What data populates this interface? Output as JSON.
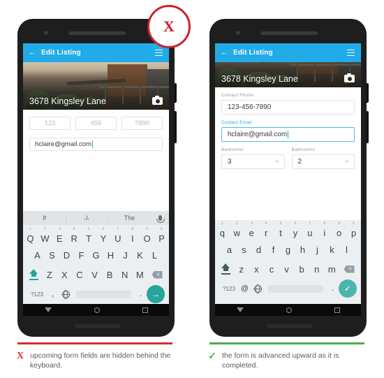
{
  "left": {
    "badge": {
      "glyph": "X",
      "name": "x-badge",
      "color": "#CE2029"
    },
    "appbar": {
      "back_icon": "back-arrow-icon",
      "title": "Edit Listing",
      "menu_icon": "hamburger-menu-icon"
    },
    "hero": {
      "caption": "3678 Kingsley Lane",
      "camera_icon": "camera-icon"
    },
    "form": {
      "phone_parts": [
        "123",
        "456",
        "7890"
      ],
      "email_value": "hclaire@gmail.com"
    },
    "keyboard": {
      "suggestions": [
        "If",
        "I",
        "The"
      ],
      "mic_icon": "microphone-icon",
      "row1": [
        "Q",
        "W",
        "E",
        "R",
        "T",
        "Y",
        "U",
        "I",
        "O",
        "P"
      ],
      "row1_nums": [
        "1",
        "2",
        "3",
        "4",
        "5",
        "6",
        "7",
        "8",
        "9",
        "0"
      ],
      "row2": [
        "A",
        "S",
        "D",
        "F",
        "G",
        "H",
        "J",
        "K",
        "L"
      ],
      "row3": [
        "Z",
        "X",
        "C",
        "V",
        "B",
        "N",
        "M"
      ],
      "shift_icon": "shift-key-icon",
      "backspace_icon": "backspace-key-icon",
      "symbols_key": "?123",
      "comma_key": ",",
      "globe_icon": "globe-language-icon",
      "period_key": ".",
      "enter_glyph": "→",
      "enter_icon": "enter-arrow-icon"
    },
    "navbar": {
      "back_icon": "nav-back-icon",
      "home_icon": "nav-home-icon",
      "recents_icon": "nav-recents-icon"
    },
    "caption": {
      "mark": "X",
      "text": "upcoming form fields are hidden behind the keyboard."
    },
    "rule_color": "#D32F2F"
  },
  "right": {
    "badge": {
      "glyph": "✓",
      "name": "check-badge",
      "color": "#2EA84F"
    },
    "appbar": {
      "back_icon": "back-arrow-icon",
      "title": "Edit Listing",
      "menu_icon": "hamburger-menu-icon"
    },
    "hero": {
      "caption": "3678 Kingsley Lane",
      "camera_icon": "camera-icon"
    },
    "form": {
      "phone_label": "Contact Phone",
      "phone_value": "123-456-7890",
      "email_label": "Contact Email",
      "email_value": "hclaire@gmail.com",
      "bedrooms_label": "Bedrooms",
      "bedrooms_value": "3",
      "bathrooms_label": "Bathrooms",
      "bathrooms_value": "2",
      "active_color": "#21ABE8"
    },
    "keyboard": {
      "row1": [
        "q",
        "w",
        "e",
        "r",
        "t",
        "y",
        "u",
        "i",
        "o",
        "p"
      ],
      "row1_nums": [
        "1",
        "2",
        "3",
        "4",
        "5",
        "6",
        "7",
        "8",
        "9",
        "0"
      ],
      "row2": [
        "a",
        "s",
        "d",
        "f",
        "g",
        "h",
        "j",
        "k",
        "l"
      ],
      "row3": [
        "z",
        "x",
        "c",
        "v",
        "b",
        "n",
        "m"
      ],
      "shift_icon": "shift-key-icon",
      "backspace_icon": "backspace-key-icon",
      "symbols_key": "?123",
      "at_key": "@",
      "globe_icon": "globe-language-icon",
      "period_key": ".",
      "enter_glyph": "✓",
      "enter_icon": "enter-check-icon"
    },
    "navbar": {
      "back_icon": "nav-back-icon",
      "home_icon": "nav-home-icon",
      "recents_icon": "nav-recents-icon"
    },
    "caption": {
      "mark": "✓",
      "text": "the form is advanced upward as it is completed."
    },
    "rule_color": "#4CAF50"
  }
}
